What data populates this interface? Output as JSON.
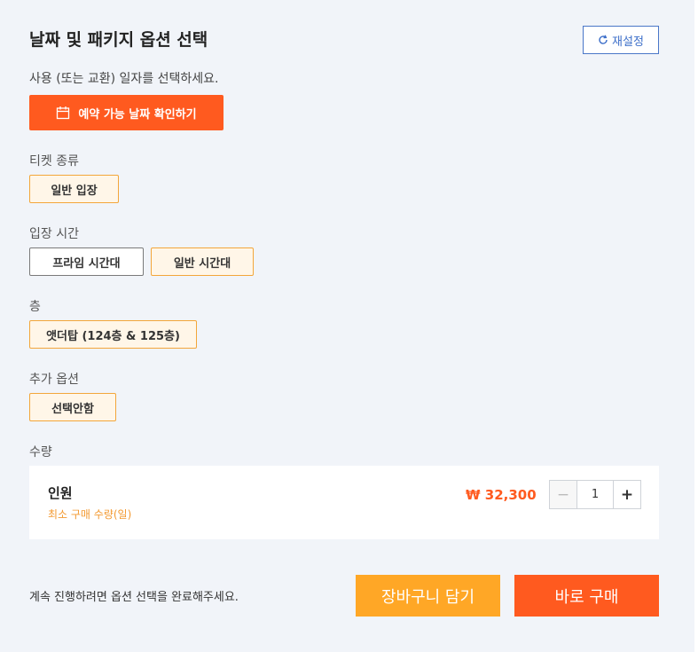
{
  "header": {
    "title": "날짜 및 패키지 옵션 선택",
    "reset_label": "재설정",
    "subtitle": "사용 (또는 교환) 일자를 선택하세요.",
    "date_button_label": "예약 가능 날짜 확인하기"
  },
  "sections": {
    "ticket_type": {
      "label": "티켓 종류",
      "options": [
        "일반 입장"
      ],
      "selected": "일반 입장"
    },
    "entry_time": {
      "label": "입장 시간",
      "options": [
        "프라임 시간대",
        "일반 시간대"
      ],
      "selected": "일반 시간대"
    },
    "floor": {
      "label": "층",
      "options": [
        "앳더탑 (124층 & 125층)"
      ],
      "selected": "앳더탑 (124층 & 125층)"
    },
    "extra_option": {
      "label": "추가 옵션",
      "options": [
        "선택안함"
      ],
      "selected": "선택안함"
    }
  },
  "quantity": {
    "label": "수량",
    "item_name": "인원",
    "min_note": "최소 구매 수량(일)",
    "price": "₩ 32,300",
    "value": "1",
    "minus_symbol": "−",
    "plus_symbol": "+"
  },
  "footer": {
    "note": "계속 진행하려면 옵션 선택을 완료해주세요.",
    "cart_label": "장바구니 담기",
    "buy_label": "바로 구매"
  },
  "colors": {
    "primary_orange": "#ff5a1f",
    "secondary_orange": "#ffa726",
    "selected_border": "#f3a63a",
    "reset_blue": "#3d6fc9",
    "panel_bg": "#f1f4f9"
  }
}
